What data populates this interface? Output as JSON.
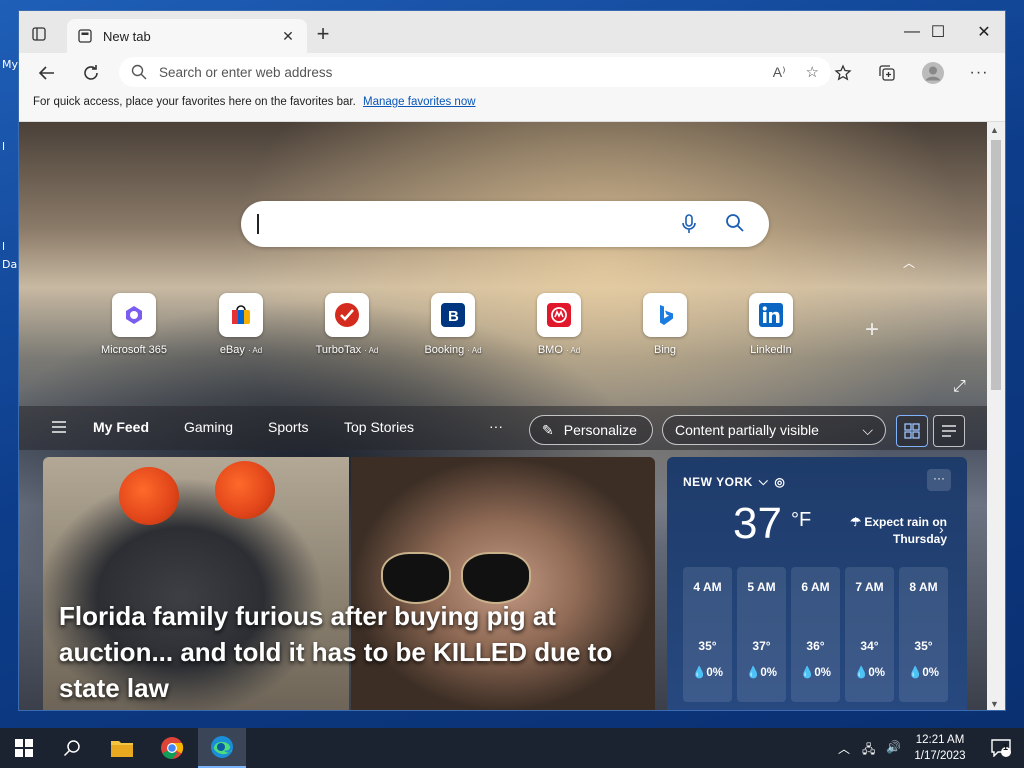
{
  "desktop": {
    "labels": [
      "My",
      "l",
      "l",
      "Da"
    ]
  },
  "browser": {
    "tab": {
      "title": "New tab",
      "close": "✕"
    },
    "new_tab": "+",
    "window_controls": {
      "minimize": "—",
      "maximize": "☐",
      "close": "✕"
    },
    "address": {
      "placeholder": "Search or enter web address"
    },
    "favorites_bar": {
      "text": "For quick access, place your favorites here on the favorites bar.",
      "link": "Manage favorites now"
    }
  },
  "newtab": {
    "quick_links": [
      {
        "label": "Microsoft 365",
        "ad": "",
        "icon": "microsoft-365-icon"
      },
      {
        "label": "eBay",
        "ad": "· Ad",
        "icon": "ebay-icon"
      },
      {
        "label": "TurboTax",
        "ad": "· Ad",
        "icon": "turbotax-icon"
      },
      {
        "label": "Booking",
        "ad": "· Ad",
        "icon": "booking-icon"
      },
      {
        "label": "BMO",
        "ad": "· Ad",
        "icon": "bmo-icon"
      },
      {
        "label": "Bing",
        "ad": "",
        "icon": "bing-icon"
      },
      {
        "label": "LinkedIn",
        "ad": "",
        "icon": "linkedin-icon"
      }
    ],
    "feed_tabs": [
      "My Feed",
      "Gaming",
      "Sports",
      "Top Stories"
    ],
    "more": "···",
    "personalize": "Personalize",
    "content_visibility": "Content partially visible",
    "news": {
      "headline": "Florida family furious after buying pig at auction... and told it has to be KILLED due to state law"
    },
    "weather": {
      "location": "NEW YORK",
      "temp": "37",
      "unit": "°F",
      "forecast": "Expect rain on Thursday",
      "more": "···",
      "hourly": [
        {
          "time": "4 AM",
          "temp": "35°",
          "rain": "0%"
        },
        {
          "time": "5 AM",
          "temp": "37°",
          "rain": "0%"
        },
        {
          "time": "6 AM",
          "temp": "36°",
          "rain": "0%"
        },
        {
          "time": "7 AM",
          "temp": "34°",
          "rain": "0%"
        },
        {
          "time": "8 AM",
          "temp": "35°",
          "rain": "0%"
        }
      ]
    }
  },
  "taskbar": {
    "time": "12:21 AM",
    "date": "1/17/2023",
    "notifications": "1"
  },
  "colors": {
    "accent": "#0b57b8",
    "taskbar": "#1b2330",
    "weather_bg": "#27497f"
  }
}
